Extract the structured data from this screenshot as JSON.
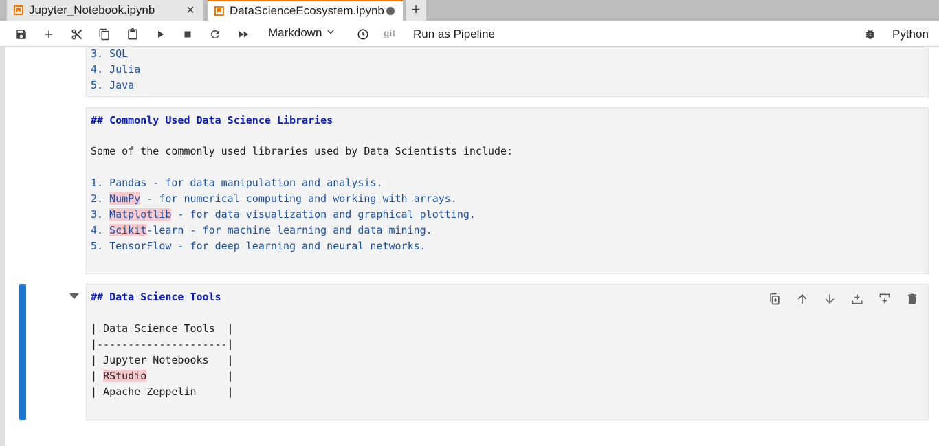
{
  "tabs": [
    {
      "label": "Jupyter_Notebook.ipynb",
      "close": "×"
    },
    {
      "label": "DataScienceEcosystem.ipynb"
    }
  ],
  "tab_add": "+",
  "toolbar": {
    "cell_type": "Markdown",
    "git": "git",
    "pipeline": "Run as Pipeline",
    "kernel": "Python"
  },
  "cell1": {
    "lines": [
      "3. SQL",
      "4. Julia",
      "5. Java"
    ]
  },
  "cell2": {
    "heading": "## Commonly Used Data Science Libraries",
    "intro": "Some of the commonly used libraries used by Data Scientists include:",
    "items": [
      {
        "num": "1. ",
        "name": "Pandas",
        "desc": " - for data manipulation and analysis."
      },
      {
        "num": "2. ",
        "name": "NumPy",
        "desc": " - for numerical computing and working with arrays."
      },
      {
        "num": "3. ",
        "name": "Matplotlib",
        "desc": " - for data visualization and graphical plotting."
      },
      {
        "num": "4. ",
        "name": "Scikit",
        "desc": "-learn - for machine learning and data mining."
      },
      {
        "num": "5. ",
        "name": "TensorFlow",
        "desc": " - for deep learning and neural networks."
      }
    ]
  },
  "cell3": {
    "heading": "## Data Science Tools",
    "table": [
      {
        "pre": "| Data Science Tools  |",
        "word": "",
        "post": ""
      },
      {
        "pre": "|---------------------|",
        "word": "",
        "post": ""
      },
      {
        "pre": "| Jupyter Notebooks   |",
        "word": "",
        "post": ""
      },
      {
        "pre": "| ",
        "word": "RStudio",
        "post": "             |"
      },
      {
        "pre": "| Apache Zeppelin     |",
        "word": "",
        "post": ""
      }
    ]
  },
  "colors": {
    "accent": "#f57c00",
    "active_cell": "#1976d2",
    "markdown_heading": "#0b1dc9",
    "list_text": "#1a52a8",
    "spell_highlight": "#f7c9cd"
  }
}
